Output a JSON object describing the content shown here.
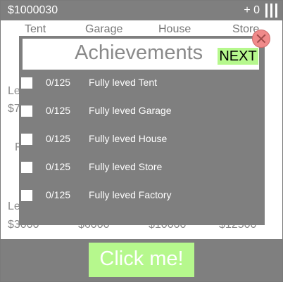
{
  "header": {
    "money": "$1000030",
    "plus": "+ 0"
  },
  "tabs": [
    "Tent",
    "Garage",
    "House",
    "Store"
  ],
  "background": {
    "row1": [
      "Le",
      "$7"
    ],
    "row2": "F",
    "row3": "Le",
    "prices": [
      "$3000",
      "$6000",
      "$10000",
      "$12500"
    ]
  },
  "modal": {
    "title": "Achievements",
    "next_label": "NEXT",
    "achievements": [
      {
        "count": "0/125",
        "label": "Fully leved Tent"
      },
      {
        "count": "0/125",
        "label": "Fully leved Garage"
      },
      {
        "count": "0/125",
        "label": "Fully leved House"
      },
      {
        "count": "0/125",
        "label": "Fully leved Store"
      },
      {
        "count": "0/125",
        "label": "Fully leved Factory"
      }
    ]
  },
  "click_button": "Click me!",
  "colors": {
    "bar": "#7f7f7f",
    "accent_green": "#b6f88d",
    "close_red": "#f08a8a"
  }
}
